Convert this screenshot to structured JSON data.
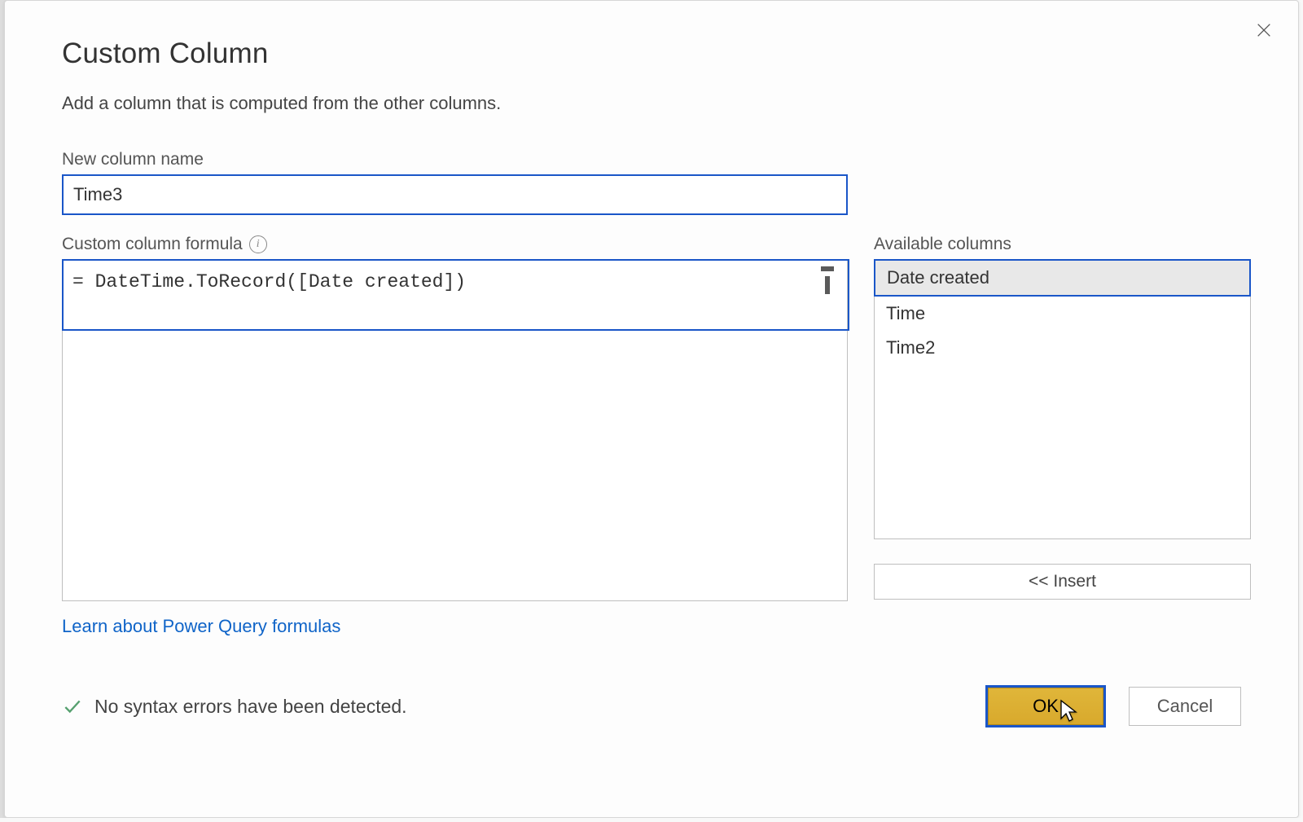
{
  "dialog": {
    "title": "Custom Column",
    "subtitle": "Add a column that is computed from the other columns.",
    "close_tooltip": "Close"
  },
  "column_name": {
    "label": "New column name",
    "value": "Time3"
  },
  "formula": {
    "label": "Custom column formula",
    "value": "= DateTime.ToRecord([Date created])"
  },
  "available": {
    "label": "Available columns",
    "items": [
      "Date created",
      "Time",
      "Time2"
    ],
    "selected_index": 0
  },
  "insert_button": "<< Insert",
  "learn_link": "Learn about Power Query formulas",
  "status": {
    "message": "No syntax errors have been detected.",
    "ok": true
  },
  "buttons": {
    "ok": "OK",
    "cancel": "Cancel"
  }
}
